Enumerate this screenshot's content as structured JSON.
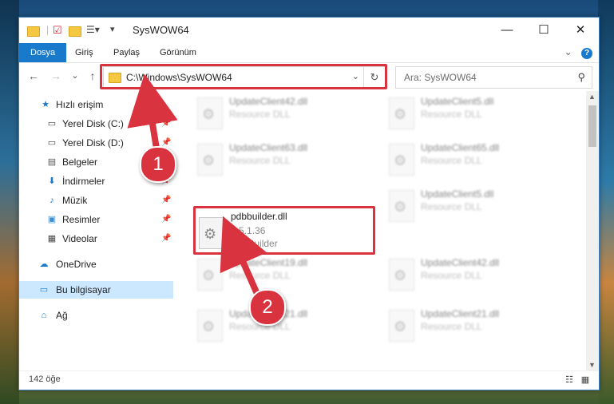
{
  "window": {
    "title": "SysWOW64"
  },
  "controls": {
    "minimize": "—",
    "maximize": "☐",
    "close": "✕"
  },
  "ribbon": {
    "tabs": [
      "Dosya",
      "Giriş",
      "Paylaş",
      "Görünüm"
    ],
    "expand": "⌄",
    "help": "?"
  },
  "nav": {
    "back": "←",
    "forward": "→",
    "recent": "⌄",
    "up": "↑"
  },
  "address": {
    "path": "C:\\Windows\\SysWOW64",
    "dropdown": "⌄",
    "refresh": "↻"
  },
  "search": {
    "placeholder": "Ara: SysWOW64",
    "icon": "⚲"
  },
  "sidebar": {
    "quick_access": "Hızlı erişim",
    "items": [
      {
        "label": "Yerel Disk (C:)",
        "pinned": true
      },
      {
        "label": "Yerel Disk (D:)",
        "pinned": true
      },
      {
        "label": "Belgeler",
        "pinned": true
      },
      {
        "label": "İndirmeler",
        "pinned": true
      },
      {
        "label": "Müzik",
        "pinned": true
      },
      {
        "label": "Resimler",
        "pinned": true
      },
      {
        "label": "Videolar",
        "pinned": true
      }
    ],
    "onedrive": "OneDrive",
    "this_pc": "Bu bilgisayar",
    "network": "Ağ",
    "pin_glyph": "📌"
  },
  "files": {
    "left": [
      {
        "name": "UpdateClient42.dll",
        "sub": "Resource DLL"
      },
      {
        "name": "UpdateClient63.dll",
        "sub": "Resource DLL"
      },
      {
        "name": "pdbbuilder.dll",
        "version": "1.5.1.36",
        "sub": "PdbBuilder"
      },
      {
        "name": "UpdateClient19.dll",
        "sub": "Resource DLL"
      },
      {
        "name": "UpdateClient21.dll",
        "sub": "Resource DLL"
      }
    ],
    "right": [
      {
        "name": "UpdateClient5.dll",
        "sub": "Resource DLL"
      },
      {
        "name": "UpdateClient65.dll",
        "sub": "Resource DLL"
      },
      {
        "name": "UpdateClient5.dll",
        "sub": "Resource DLL"
      },
      {
        "name": "UpdateClient42.dll",
        "sub": "Resource DLL"
      },
      {
        "name": "UpdateClient21.dll",
        "sub": "Resource DLL"
      }
    ]
  },
  "status": {
    "count": "142 öğe"
  },
  "callouts": [
    "1",
    "2"
  ],
  "colors": {
    "accent": "#1979ca",
    "highlight": "#d9333f",
    "selected": "#cce8ff"
  }
}
